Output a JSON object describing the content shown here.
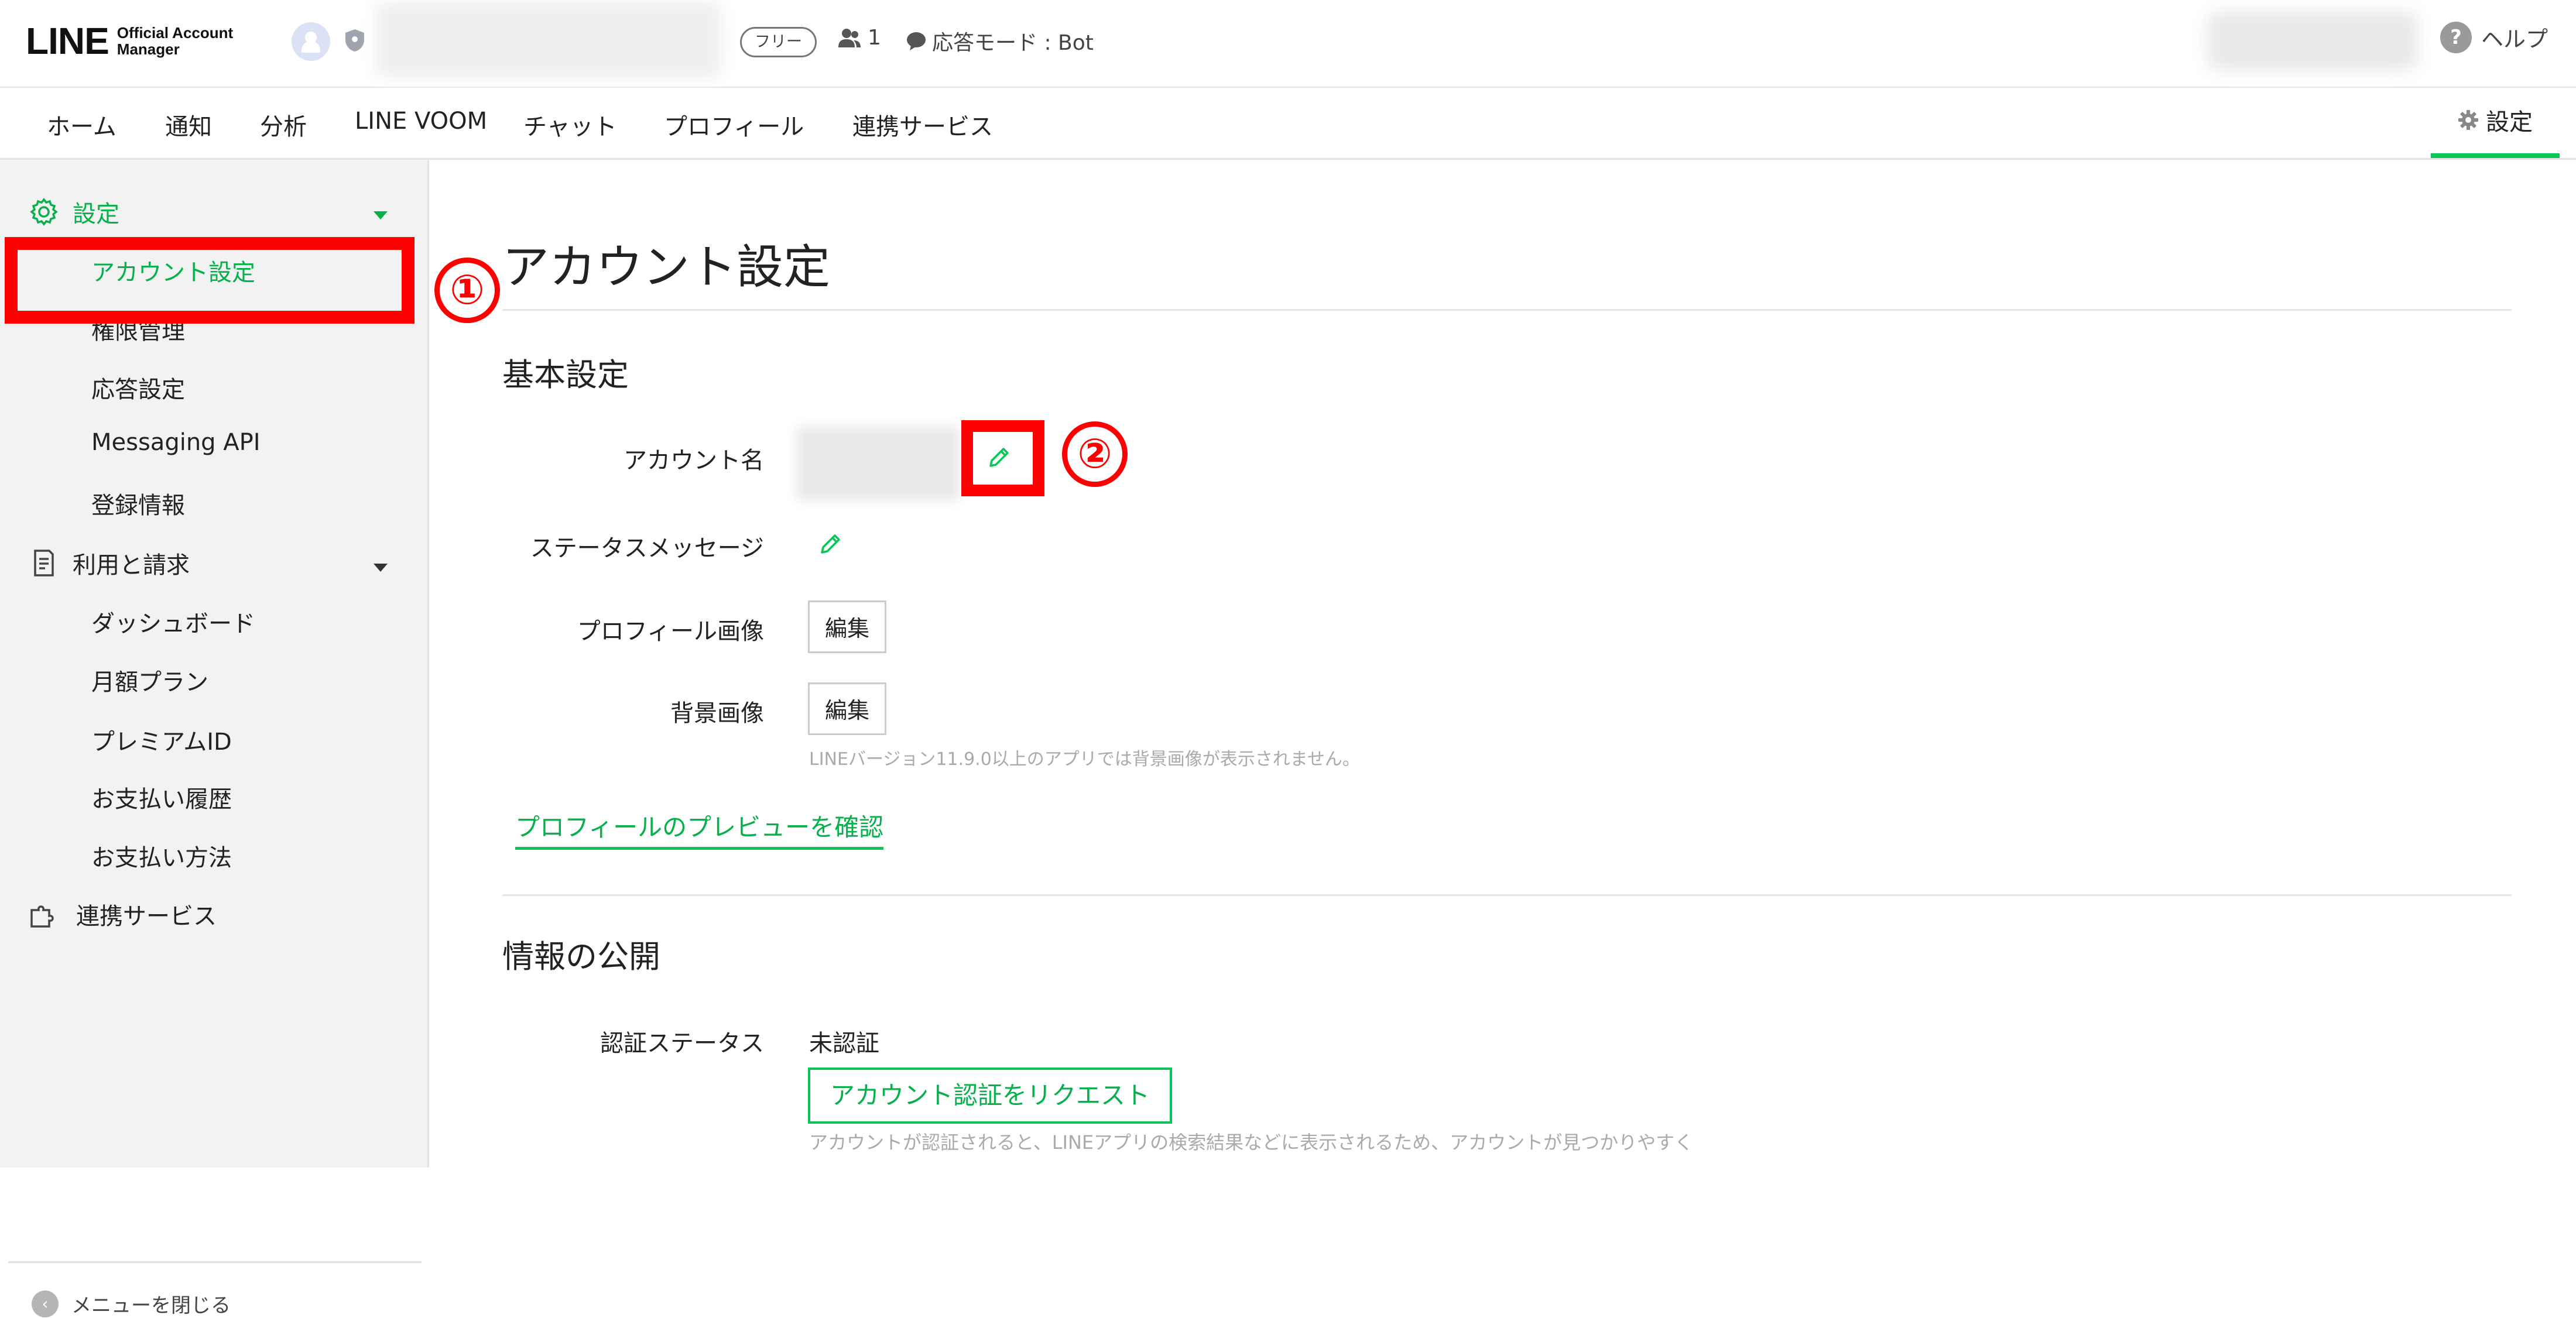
{
  "topbar": {
    "logo_main": "LINE",
    "logo_sub_1": "Official Account",
    "logo_sub_2": "Manager",
    "plan_badge": "フリー",
    "follower_count": "1",
    "response_mode": "応答モード : Bot",
    "help_label": "ヘルプ",
    "help_glyph": "?"
  },
  "nav": {
    "items": [
      "ホーム",
      "通知",
      "分析",
      "LINE VOOM",
      "チャット",
      "プロフィール",
      "連携サービス"
    ],
    "settings_label": "設定"
  },
  "sidebar": {
    "settings_header": "設定",
    "settings_items": [
      "アカウント設定",
      "権限管理",
      "応答設定",
      "Messaging API",
      "登録情報"
    ],
    "billing_header": "利用と請求",
    "billing_items": [
      "ダッシュボード",
      "月額プラン",
      "プレミアムID",
      "お支払い履歴",
      "お支払い方法"
    ],
    "integration_header": "連携サービス",
    "close_menu": "メニューを閉じる",
    "close_glyph": "‹"
  },
  "main": {
    "page_title": "アカウント設定",
    "basic_section_title": "基本設定",
    "account_name_label": "アカウント名",
    "status_message_label": "ステータスメッセージ",
    "profile_image_label": "プロフィール画像",
    "background_image_label": "背景画像",
    "edit_button": "編集",
    "background_note": "LINEバージョン11.9.0以上のアプリでは背景画像が表示されません。",
    "preview_link": "プロフィールのプレビューを確認",
    "public_section_title": "情報の公開",
    "auth_status_label": "認証ステータス",
    "auth_status_value": "未認証",
    "auth_request_button": "アカウント認証をリクエスト",
    "auth_note": "アカウントが認証されると、LINEアプリの検索結果などに表示されるため、アカウントが見つかりやすく"
  },
  "annotations": {
    "marker_1": "①",
    "marker_2": "②"
  },
  "colors": {
    "accent_green": "#06c755",
    "annotation_red": "#ff0000"
  },
  "icons": [
    "shield-icon",
    "person-icon",
    "chat-bubble-icon",
    "help-icon",
    "gear-icon",
    "document-icon",
    "puzzle-icon",
    "pencil-icon",
    "chevron-left-icon",
    "caret-down-icon"
  ]
}
